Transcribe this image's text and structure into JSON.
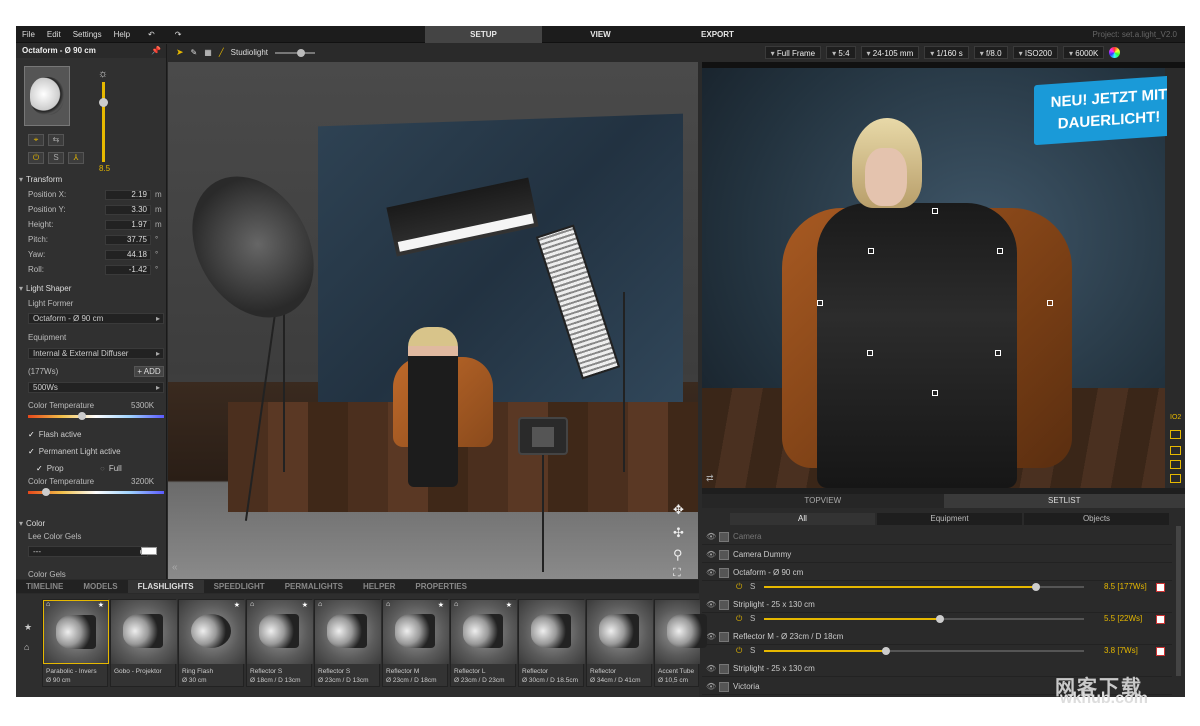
{
  "menu": {
    "items": [
      "File",
      "Edit",
      "Settings",
      "Help"
    ]
  },
  "modes": [
    "SETUP",
    "VIEW",
    "EXPORT"
  ],
  "project": "Project: set.a.light_V2.0",
  "left": {
    "title": "Octaform - Ø 90 cm",
    "intensity": "8.5",
    "transform_label": "Transform",
    "fields": [
      {
        "label": "Position X:",
        "value": "2.19",
        "unit": "m"
      },
      {
        "label": "Position Y:",
        "value": "3.30",
        "unit": "m"
      },
      {
        "label": "Height:",
        "value": "1.97",
        "unit": "m"
      },
      {
        "label": "Pitch:",
        "value": "37.75",
        "unit": "°"
      },
      {
        "label": "Yaw:",
        "value": "44.18",
        "unit": "°"
      },
      {
        "label": "Roll:",
        "value": "-1.42",
        "unit": "°"
      }
    ],
    "light_shaper": "Light Shaper",
    "light_former": "Light Former",
    "former_value": "Octaform - Ø 90 cm",
    "equipment": "Equipment",
    "equipment_value": "Internal & External Diffuser",
    "power_label": "(177Ws)",
    "add": "ADD",
    "power_value": "500Ws",
    "color_temp_label": "Color Temperature",
    "color_temp_1": "5300K",
    "flash_active": "Flash active",
    "perm_active": "Permanent Light active",
    "prop": "Prop",
    "full": "Full",
    "color_temp_2": "3200K",
    "color_label": "Color",
    "lee_gels": "Lee Color Gels",
    "gel_value": "---",
    "color_gels": "Color Gels"
  },
  "viewport": {
    "preset": "Studiolight"
  },
  "camera_bar": [
    "Full Frame",
    "5:4",
    "24-105 mm",
    "1/160 s",
    "f/8.0",
    "ISO200",
    "6000K"
  ],
  "badge": {
    "line1": "NEU! JETZT MIT",
    "line2": "DAUERLICHT!"
  },
  "right_tabs": [
    "TOPVIEW",
    "SETLIST"
  ],
  "setlist_tabs": [
    "All",
    "Equipment",
    "Objects"
  ],
  "setlist": [
    {
      "name": "Camera"
    },
    {
      "name": "Camera Dummy"
    },
    {
      "name": "Octaform - Ø 90 cm",
      "value": "8.5 [177Ws]",
      "level": 0.85
    },
    {
      "name": "Striplight - 25 x 130 cm",
      "value": "5.5 [22Ws]",
      "level": 0.55
    },
    {
      "name": "Reflector M - Ø 23cm / D 18cm",
      "value": "3.8 [7Ws]",
      "level": 0.38
    },
    {
      "name": "Striplight - 25 x 130 cm"
    },
    {
      "name": "Victoria"
    }
  ],
  "bottom_tabs": [
    "TIMELINE",
    "MODELS",
    "FLASHLIGHTS",
    "SPEEDLIGHT",
    "PERMALIGHTS",
    "HELPER",
    "PROPERTIES"
  ],
  "library": [
    {
      "n1": "Parabolic - Invers",
      "n2": "Ø 90 cm"
    },
    {
      "n1": "Gobo - Projektor",
      "n2": ""
    },
    {
      "n1": "Ring Flash",
      "n2": "Ø 30 cm"
    },
    {
      "n1": "Reflector S",
      "n2": "Ø 18cm / D 13cm"
    },
    {
      "n1": "Reflector S",
      "n2": "Ø 23cm / D 13cm"
    },
    {
      "n1": "Reflector M",
      "n2": "Ø 23cm / D 18cm"
    },
    {
      "n1": "Reflector L",
      "n2": "Ø 23cm / D 23cm"
    },
    {
      "n1": "Reflector",
      "n2": "Ø 30cm / D 18.5cm"
    },
    {
      "n1": "Reflector",
      "n2": "Ø 34cm / D 41cm"
    },
    {
      "n1": "Accent Tube",
      "n2": "Ø 10,5 cm"
    }
  ],
  "watermark": {
    "cn": "网客下载",
    "url": "wkhub.com"
  },
  "colors": {
    "accent": "#e6b800",
    "badge": "#1a9ad8"
  }
}
